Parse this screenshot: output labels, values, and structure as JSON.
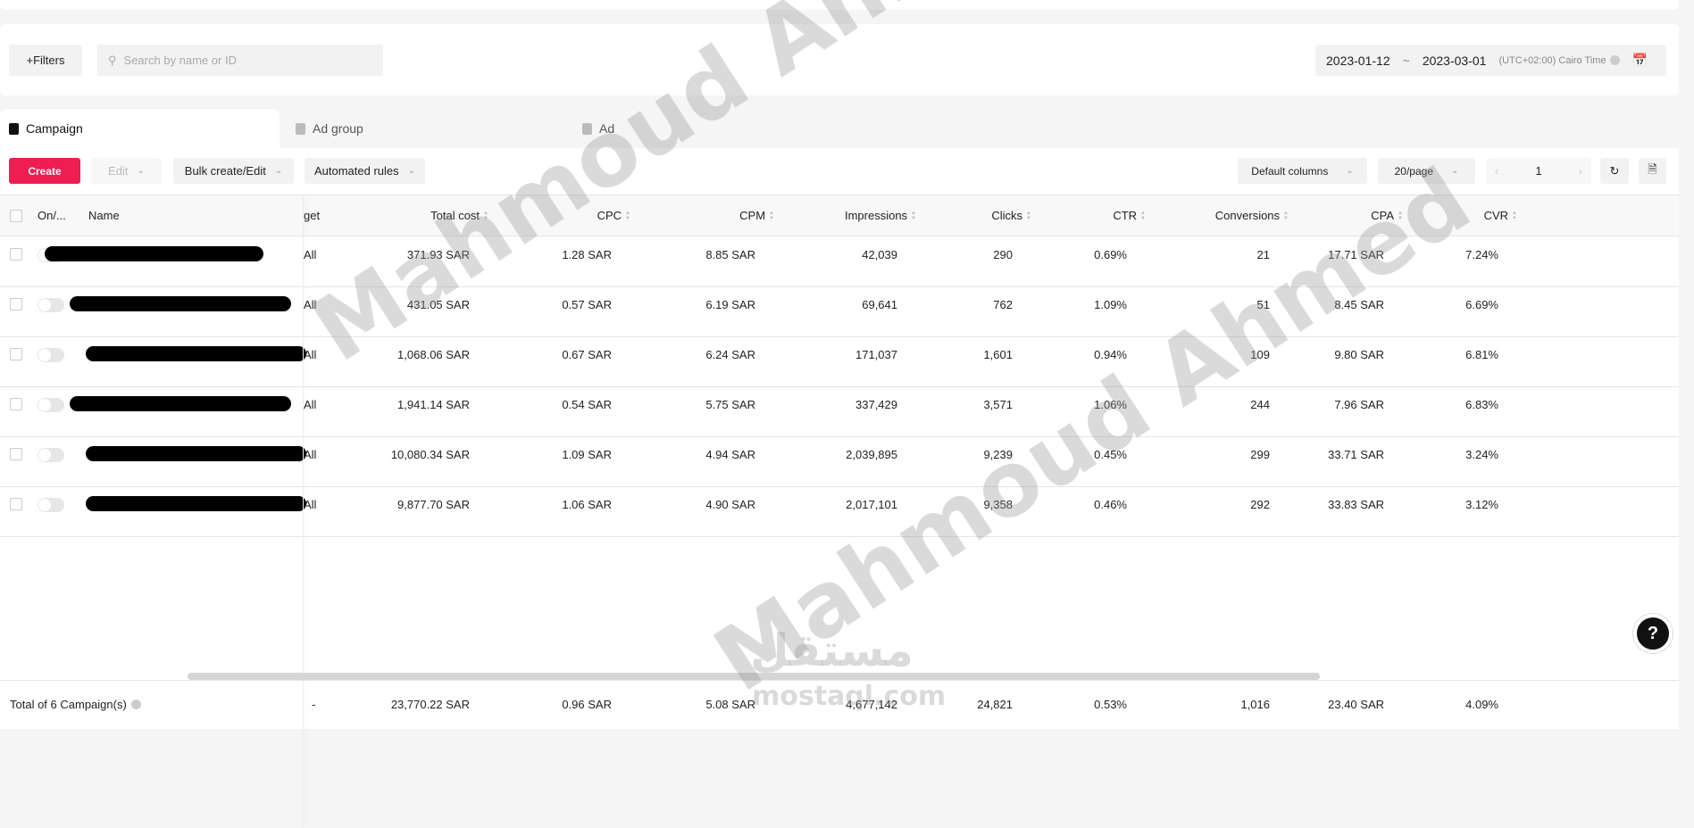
{
  "filters": {
    "filters_label": "+Filters",
    "search_placeholder": "Search by name or ID"
  },
  "date": {
    "start": "2023-01-12",
    "sep": "~",
    "end": "2023-03-01",
    "timezone": "(UTC+02:00) Cairo Time"
  },
  "tabs": [
    {
      "label": "Campaign"
    },
    {
      "label": "Ad group"
    },
    {
      "label": "Ad"
    }
  ],
  "toolbar": {
    "create": "Create",
    "edit": "Edit",
    "bulk": "Bulk create/Edit",
    "rules": "Automated rules",
    "columns": "Default columns",
    "per_page": "20/page",
    "page": "1"
  },
  "columns": {
    "onoff": "On/...",
    "name": "Name",
    "budget": "get",
    "total_cost": "Total cost",
    "cpc": "CPC",
    "cpm": "CPM",
    "impressions": "Impressions",
    "clicks": "Clicks",
    "ctr": "CTR",
    "conversions": "Conversions",
    "cpa": "CPA",
    "cvr": "CVR"
  },
  "rows": [
    {
      "budget": "All",
      "total_cost": "371.93 SAR",
      "cpc": "1.28 SAR",
      "cpm": "8.85 SAR",
      "impressions": "42,039",
      "clicks": "290",
      "ctr": "0.69%",
      "conversions": "21",
      "cpa": "17.71 SAR",
      "cvr": "7.24%"
    },
    {
      "budget": "All",
      "total_cost": "431.05 SAR",
      "cpc": "0.57 SAR",
      "cpm": "6.19 SAR",
      "impressions": "69,641",
      "clicks": "762",
      "ctr": "1.09%",
      "conversions": "51",
      "cpa": "8.45 SAR",
      "cvr": "6.69%"
    },
    {
      "budget": "All",
      "total_cost": "1,068.06 SAR",
      "cpc": "0.67 SAR",
      "cpm": "6.24 SAR",
      "impressions": "171,037",
      "clicks": "1,601",
      "ctr": "0.94%",
      "conversions": "109",
      "cpa": "9.80 SAR",
      "cvr": "6.81%"
    },
    {
      "budget": "All",
      "total_cost": "1,941.14 SAR",
      "cpc": "0.54 SAR",
      "cpm": "5.75 SAR",
      "impressions": "337,429",
      "clicks": "3,571",
      "ctr": "1.06%",
      "conversions": "244",
      "cpa": "7.96 SAR",
      "cvr": "6.83%"
    },
    {
      "budget": "All",
      "total_cost": "10,080.34 SAR",
      "cpc": "1.09 SAR",
      "cpm": "4.94 SAR",
      "impressions": "2,039,895",
      "clicks": "9,239",
      "ctr": "0.45%",
      "conversions": "299",
      "cpa": "33.71 SAR",
      "cvr": "3.24%"
    },
    {
      "budget": "All",
      "total_cost": "9,877.70 SAR",
      "cpc": "1.06 SAR",
      "cpm": "4.90 SAR",
      "impressions": "2,017,101",
      "clicks": "9,358",
      "ctr": "0.46%",
      "conversions": "292",
      "cpa": "33.83 SAR",
      "cvr": "3.12%"
    }
  ],
  "total": {
    "label": "Total of 6 Campaign(s)",
    "budget": "-",
    "total_cost": "23,770.22 SAR",
    "cpc": "0.96 SAR",
    "cpm": "5.08 SAR",
    "impressions": "4,677,142",
    "clicks": "24,821",
    "ctr": "0.53%",
    "conversions": "1,016",
    "cpa": "23.40 SAR",
    "cvr": "4.09%"
  },
  "help": "?",
  "watermark": {
    "text1": "Mahmoud Ahmed",
    "text2": "Mahmoud Ahmed",
    "logo_ar": "مستقل",
    "logo": "mostaql.com"
  },
  "colors": {
    "accent": "#ee1d52"
  }
}
